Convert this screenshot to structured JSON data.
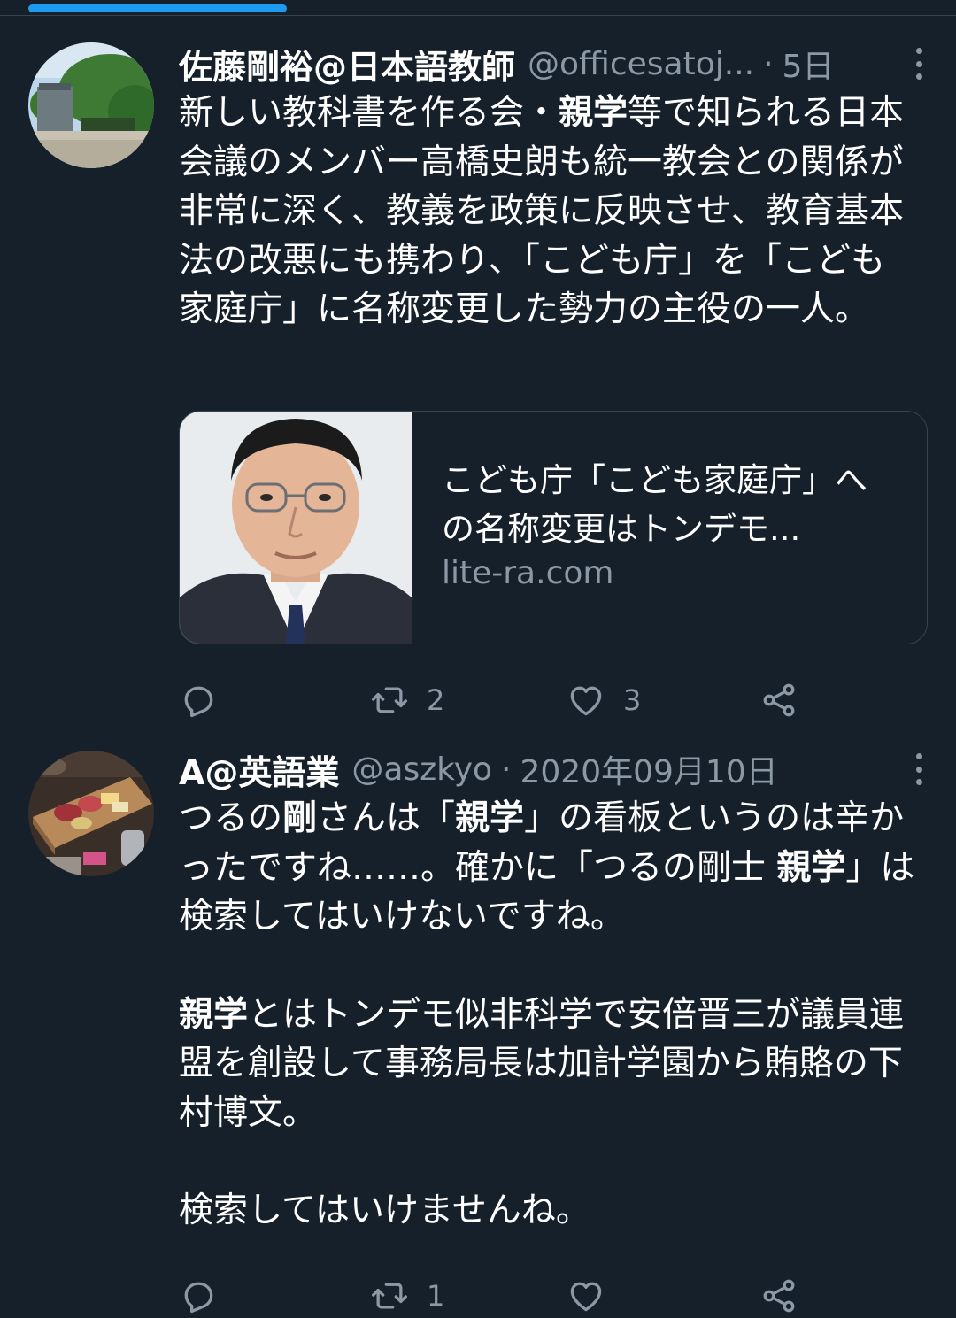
{
  "colors": {
    "background": "#15202b",
    "text": "#ffffff",
    "muted": "#8b98a5",
    "border": "#38444d",
    "accent": "#1d9bf0"
  },
  "progress": {
    "fraction": 0.27
  },
  "tweets": [
    {
      "name": "佐藤剛裕@日本語教師",
      "handle": "@officesatoj...",
      "separator": "·",
      "date": "5日",
      "text": [
        "新しい教科書を作る会・",
        "親学",
        "等で知られる日本会議のメンバー高橋史朗も統一教会との関係が非常に深く、教義を政策に反映させ、教育基本法の改悪にも携わり、「こども庁」を「こども家庭庁」に名称変更した勢力の主役の一人。"
      ],
      "card": {
        "title": "こども庁「こども家庭庁」への名称変更はトンデモ...",
        "domain": "lite-ra.com"
      },
      "actions": {
        "reply": "",
        "retweet": "2",
        "like": "3",
        "share": ""
      }
    },
    {
      "name": "A@英語業",
      "handle": "@aszkyo",
      "separator": "·",
      "date": "2020年09月10日",
      "text": [
        "つるの",
        "剛",
        "さんは「",
        "親学",
        "」の看板というのは辛かったですね……。確かに「つるの剛士 ",
        "親学",
        "」は検索してはいけないですね。",
        "親学",
        "とはトンデモ似非科学で安倍晋三が議員連盟を創設して事務局長は加計学園から賄賂の下村博文。",
        "検索してはいけませんね。"
      ],
      "actions": {
        "reply": "",
        "retweet": "1",
        "like": "",
        "share": ""
      }
    }
  ]
}
